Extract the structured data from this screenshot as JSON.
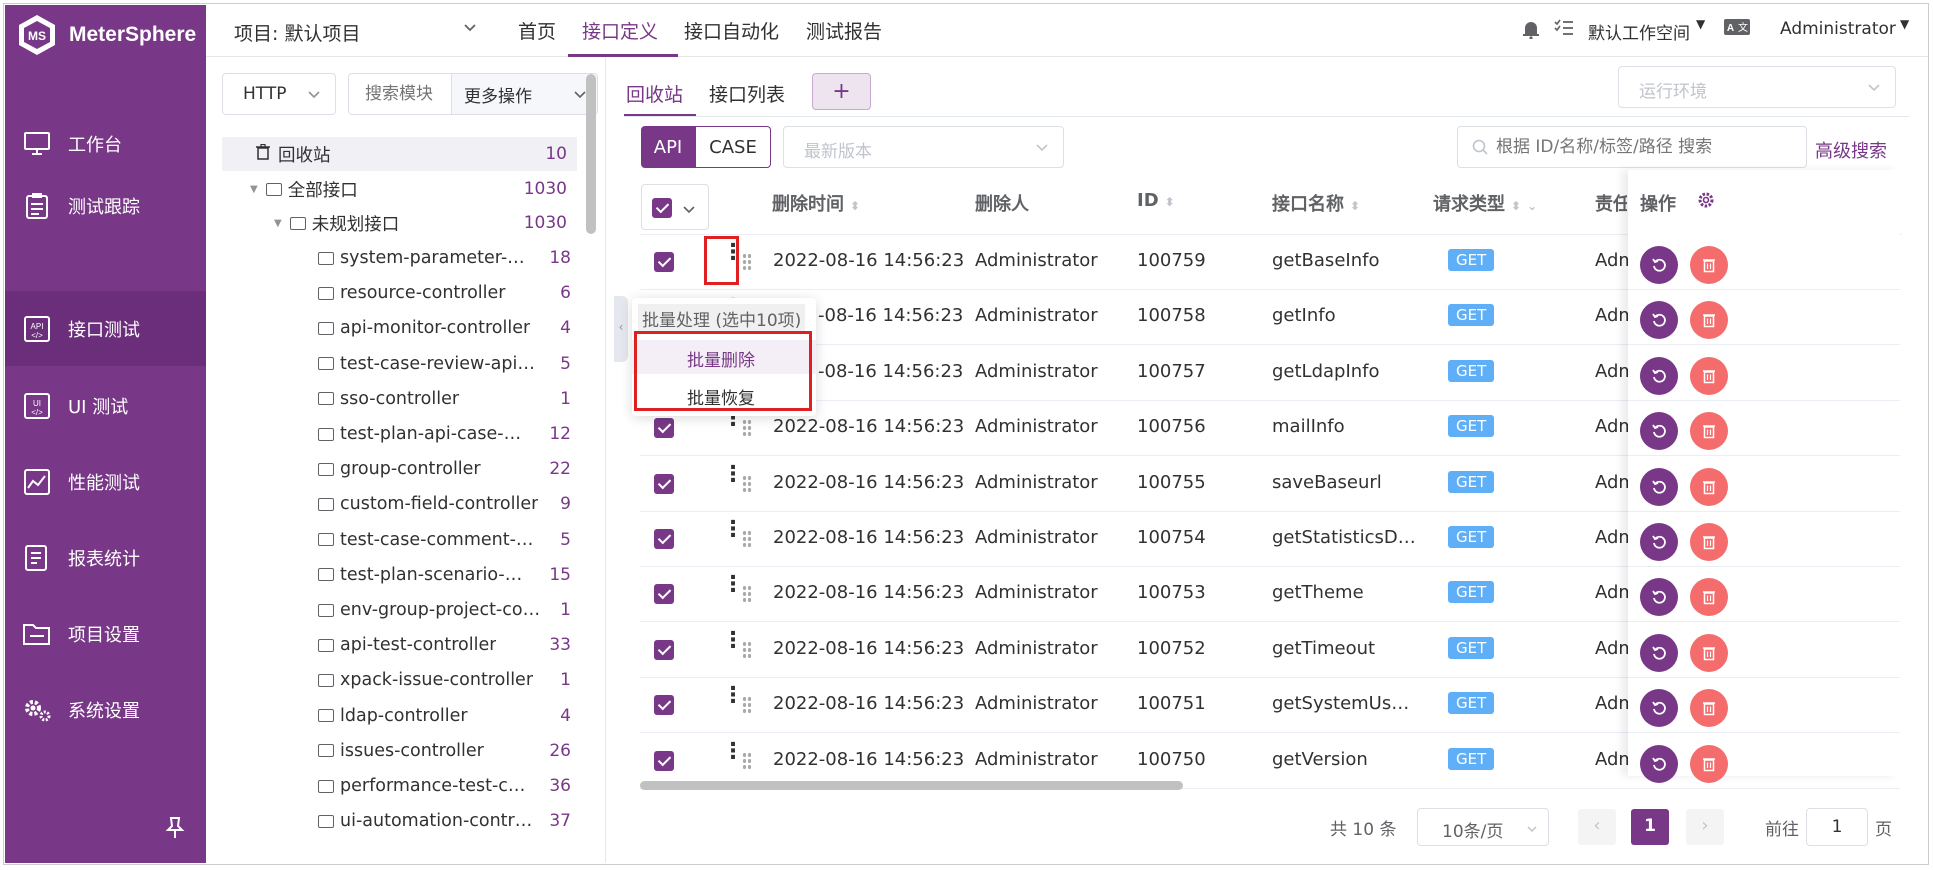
{
  "app": {
    "name": "MeterSphere"
  },
  "sidebar": {
    "items": [
      {
        "label": "工作台",
        "icon": "monitor-icon"
      },
      {
        "label": "测试跟踪",
        "icon": "clipboard-icon"
      },
      {
        "label": "接口测试",
        "icon": "api-icon",
        "active": true
      },
      {
        "label": "UI 测试",
        "icon": "ui-icon"
      },
      {
        "label": "性能测试",
        "icon": "chart-icon"
      },
      {
        "label": "报表统计",
        "icon": "report-icon"
      },
      {
        "label": "项目设置",
        "icon": "folder-icon"
      },
      {
        "label": "系统设置",
        "icon": "gears-icon"
      }
    ]
  },
  "header": {
    "project": "项目: 默认项目",
    "nav": [
      "首页",
      "接口定义",
      "接口自动化",
      "测试报告"
    ],
    "workspace": "默认工作空间",
    "user": "Administrator"
  },
  "tree": {
    "protocol": "HTTP",
    "search_placeholder": "搜索模块",
    "more_ops": "更多操作",
    "recycle": {
      "label": "回收站",
      "count": "10"
    },
    "all": {
      "label": "全部接口",
      "count": "1030"
    },
    "unplanned": {
      "label": "未规划接口",
      "count": "1030"
    },
    "modules": [
      {
        "label": "system-parameter-…",
        "count": "18"
      },
      {
        "label": "resource-controller",
        "count": "6"
      },
      {
        "label": "api-monitor-controller",
        "count": "4"
      },
      {
        "label": "test-case-review-api…",
        "count": "5"
      },
      {
        "label": "sso-controller",
        "count": "1"
      },
      {
        "label": "test-plan-api-case-…",
        "count": "12"
      },
      {
        "label": "group-controller",
        "count": "22"
      },
      {
        "label": "custom-field-controller",
        "count": "9"
      },
      {
        "label": "test-case-comment-…",
        "count": "5"
      },
      {
        "label": "test-plan-scenario-…",
        "count": "15"
      },
      {
        "label": "env-group-project-co…",
        "count": "1"
      },
      {
        "label": "api-test-controller",
        "count": "33"
      },
      {
        "label": "xpack-issue-controller",
        "count": "1"
      },
      {
        "label": "ldap-controller",
        "count": "4"
      },
      {
        "label": "issues-controller",
        "count": "26"
      },
      {
        "label": "performance-test-c…",
        "count": "36"
      },
      {
        "label": "ui-automation-contr…",
        "count": "37"
      }
    ]
  },
  "main": {
    "tabs": [
      "回收站",
      "接口列表"
    ],
    "add": "+",
    "env_placeholder": "运行环境",
    "toggle": [
      "API",
      "CASE"
    ],
    "version_placeholder": "最新版本",
    "search_placeholder": "根据 ID/名称/标签/路径 搜索",
    "advanced": "高级搜索",
    "columns": {
      "delete_time": "删除时间",
      "deleter": "删除人",
      "id": "ID",
      "name": "接口名称",
      "method": "请求类型",
      "owner": "责任",
      "ops": "操作"
    },
    "rows": [
      {
        "time": "2022-08-16 14:56:23",
        "user": "Administrator",
        "id": "100759",
        "name": "getBaseInfo",
        "method": "GET",
        "owner": "Adm"
      },
      {
        "time": "-08-16 14:56:23",
        "user": "Administrator",
        "id": "100758",
        "name": "getInfo",
        "method": "GET",
        "owner": "Adm"
      },
      {
        "time": "-08-16 14:56:23",
        "user": "Administrator",
        "id": "100757",
        "name": "getLdapInfo",
        "method": "GET",
        "owner": "Adm"
      },
      {
        "time": "2022-08-16 14:56:23",
        "user": "Administrator",
        "id": "100756",
        "name": "mailInfo",
        "method": "GET",
        "owner": "Adm"
      },
      {
        "time": "2022-08-16 14:56:23",
        "user": "Administrator",
        "id": "100755",
        "name": "saveBaseurl",
        "method": "GET",
        "owner": "Adm"
      },
      {
        "time": "2022-08-16 14:56:23",
        "user": "Administrator",
        "id": "100754",
        "name": "getStatisticsD…",
        "method": "GET",
        "owner": "Adm"
      },
      {
        "time": "2022-08-16 14:56:23",
        "user": "Administrator",
        "id": "100753",
        "name": "getTheme",
        "method": "GET",
        "owner": "Adm"
      },
      {
        "time": "2022-08-16 14:56:23",
        "user": "Administrator",
        "id": "100752",
        "name": "getTimeout",
        "method": "GET",
        "owner": "Adm"
      },
      {
        "time": "2022-08-16 14:56:23",
        "user": "Administrator",
        "id": "100751",
        "name": "getSystemUs…",
        "method": "GET",
        "owner": "Adm"
      },
      {
        "time": "2022-08-16 14:56:23",
        "user": "Administrator",
        "id": "100750",
        "name": "getVersion",
        "method": "GET",
        "owner": "Adm"
      }
    ],
    "batch": {
      "title": "批量处理 (选中10项)",
      "delete": "批量删除",
      "restore": "批量恢复"
    },
    "pager": {
      "total": "共 10 条",
      "size": "10条/页",
      "page": "1",
      "goto": "前往",
      "goto_value": "1",
      "page_unit": "页"
    }
  },
  "colors": {
    "brand": "#783887",
    "get": "#5faff8",
    "danger": "#f56c6c",
    "highlight": "#e02020"
  }
}
